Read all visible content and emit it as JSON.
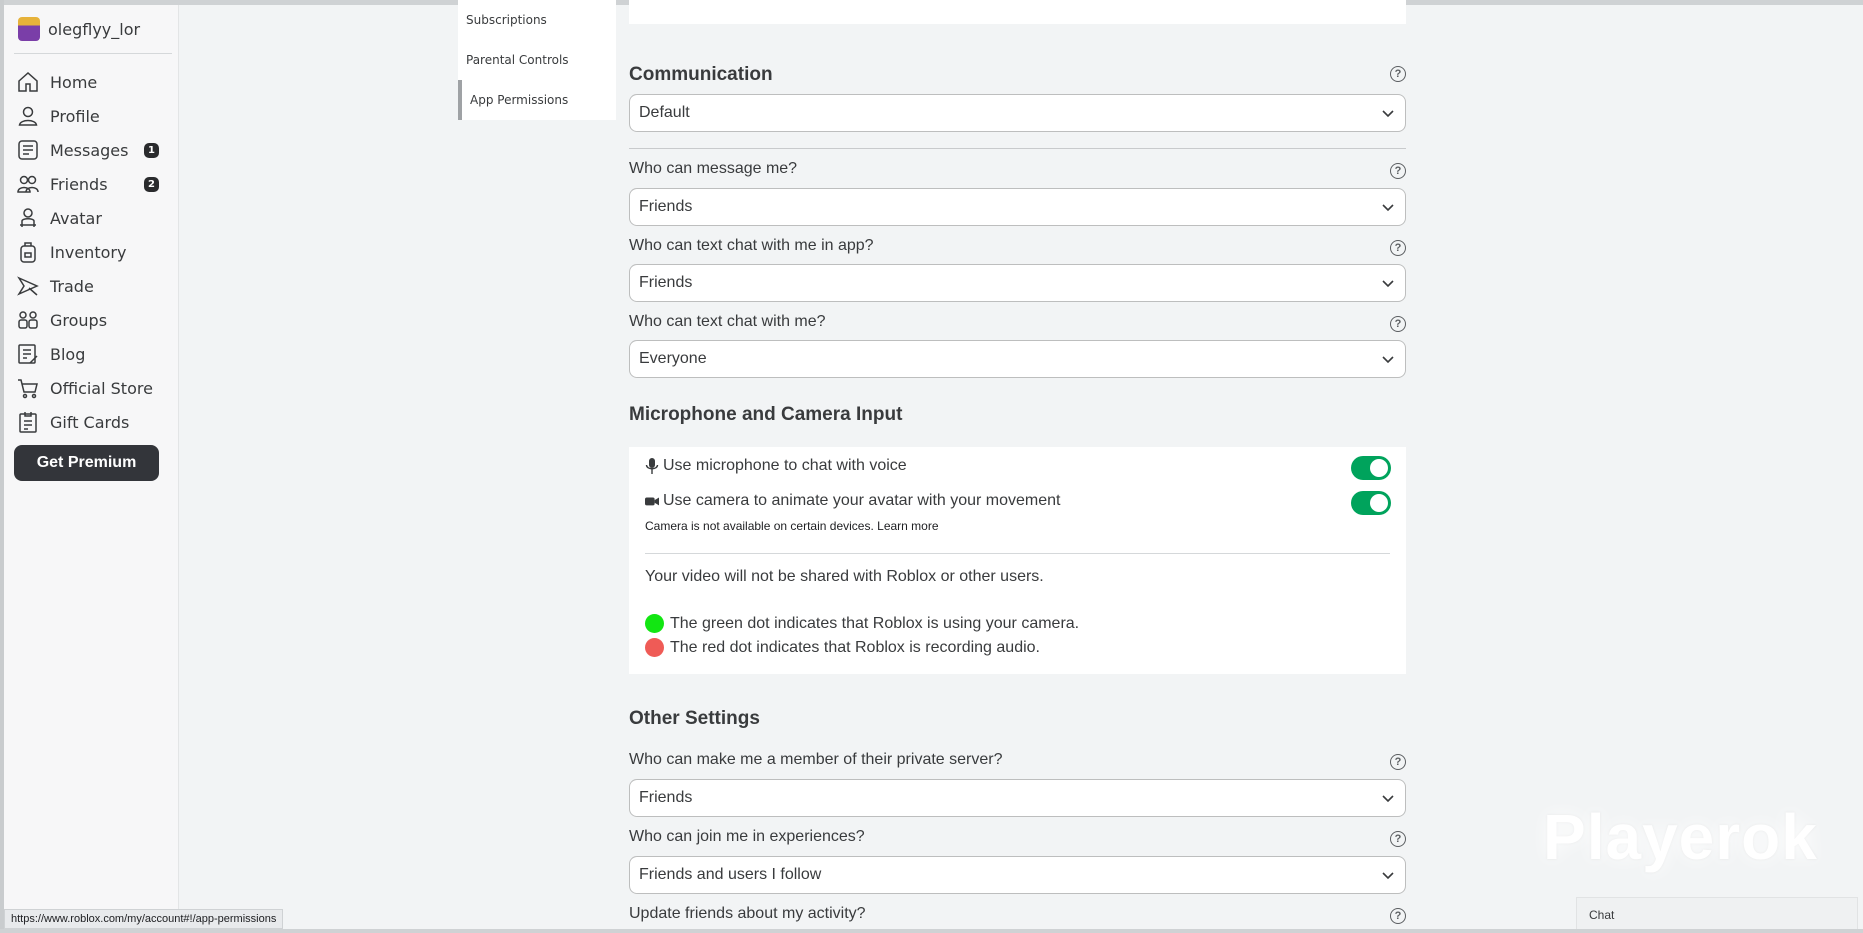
{
  "user": {
    "username": "olegflyy_lor"
  },
  "nav": {
    "items": [
      {
        "label": "Home",
        "icon": "home-icon"
      },
      {
        "label": "Profile",
        "icon": "profile-icon"
      },
      {
        "label": "Messages",
        "icon": "messages-icon",
        "badge": "1"
      },
      {
        "label": "Friends",
        "icon": "friends-icon",
        "badge": "2"
      },
      {
        "label": "Avatar",
        "icon": "avatar-icon"
      },
      {
        "label": "Inventory",
        "icon": "inventory-icon"
      },
      {
        "label": "Trade",
        "icon": "trade-icon"
      },
      {
        "label": "Groups",
        "icon": "groups-icon"
      },
      {
        "label": "Blog",
        "icon": "blog-icon"
      },
      {
        "label": "Official Store",
        "icon": "store-icon"
      },
      {
        "label": "Gift Cards",
        "icon": "gift-card-icon"
      }
    ],
    "premium_label": "Get Premium"
  },
  "settings_menu": {
    "items": [
      "Subscriptions",
      "Parental Controls",
      "App Permissions"
    ],
    "active": "App Permissions"
  },
  "communication": {
    "title": "Communication",
    "preset_value": "Default",
    "message_label": "Who can message me?",
    "message_value": "Friends",
    "text_chat_app_label": "Who can text chat with me in app?",
    "text_chat_app_value": "Friends",
    "text_chat_label": "Who can text chat with me?",
    "text_chat_value": "Everyone"
  },
  "mic_camera": {
    "title": "Microphone and Camera Input",
    "mic_label": "Use microphone to chat with voice",
    "mic_enabled": true,
    "camera_label": "Use camera to animate your avatar with your movement",
    "camera_enabled": true,
    "camera_note": "Camera is not available on certain devices.",
    "learn_more": "Learn more",
    "video_note": "Your video will not be shared with Roblox or other users.",
    "green_dot_note": "The green dot indicates that Roblox is using your camera.",
    "red_dot_note": "The red dot indicates that Roblox is recording audio."
  },
  "other": {
    "title": "Other Settings",
    "private_server_label": "Who can make me a member of their private server?",
    "private_server_value": "Friends",
    "join_label": "Who can join me in experiences?",
    "join_value": "Friends and users I follow",
    "activity_label": "Update friends about my activity?"
  },
  "help_symbol": "?",
  "watermark": "Playerok",
  "chat_label": "Chat",
  "status_url": "https://www.roblox.com/my/account#!/app-permissions",
  "colors": {
    "toggle_on": "#00a35c",
    "green_dot": "#12e612",
    "red_dot": "#ef5b56"
  }
}
